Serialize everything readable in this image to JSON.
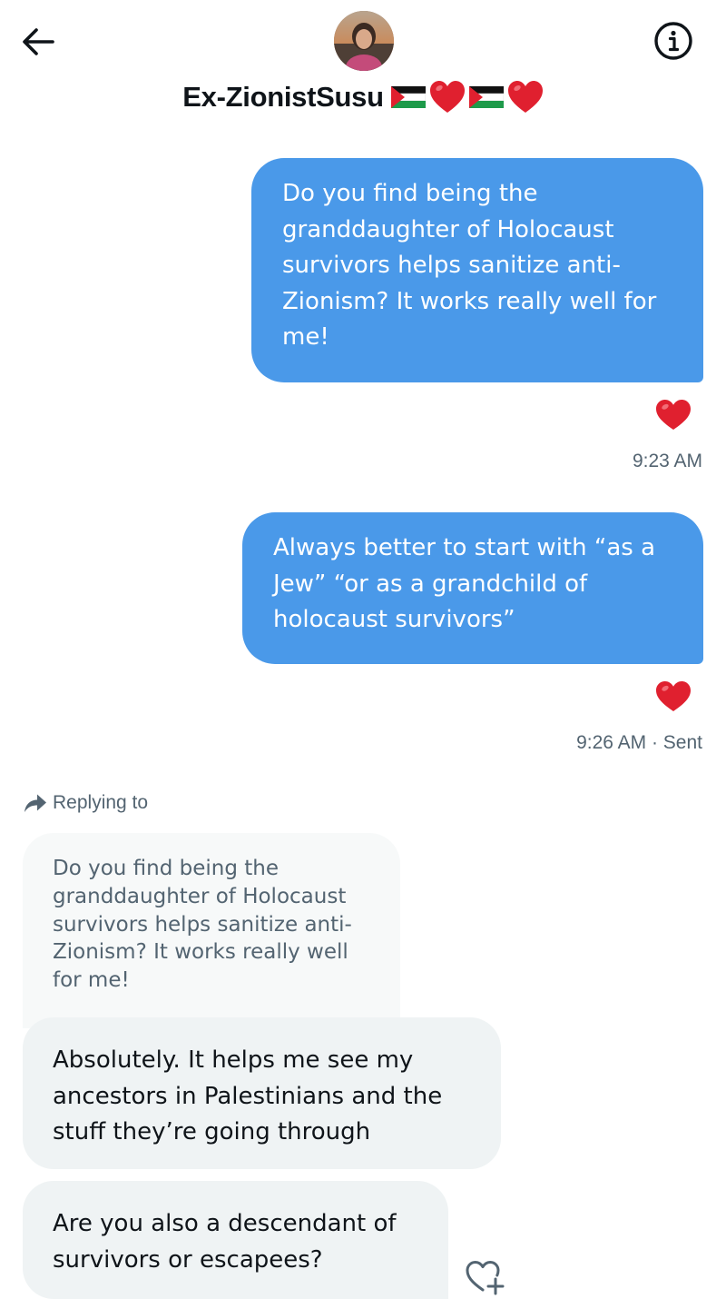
{
  "header": {
    "title": "Ex-ZionistSusu",
    "title_emoji": [
      "palestine-flag",
      "red-heart",
      "palestine-flag",
      "red-heart"
    ],
    "back_icon": "arrow-left-icon",
    "info_icon": "info-circle-icon"
  },
  "messages": [
    {
      "direction": "outgoing",
      "text": "Do you find being the granddaughter of Holocaust survivors helps sanitize anti-Zionism? It works really well for me!",
      "reaction": "red-heart",
      "time": "9:23 AM"
    },
    {
      "direction": "outgoing",
      "text": "Always better to start with “as a Jew” “or as a grandchild of holocaust survivors”",
      "reaction": "red-heart",
      "time": "9:26 AM",
      "status": "· Sent"
    }
  ],
  "reply": {
    "label": "Replying to",
    "quoted_text": "Do you find being the granddaughter of Holocaust survivors helps sanitize anti-Zionism? It works really well for me!"
  },
  "incoming": [
    {
      "text": "Absolutely. It helps me see my ancestors in Palestinians and the stuff they’re going through"
    },
    {
      "text": "Are you also a descendant of survivors or escapees?"
    }
  ],
  "colors": {
    "outgoing_bubble": "#4a99e9",
    "incoming_bubble": "#eff3f4",
    "quoted_bubble": "#f7f9f9",
    "secondary_text": "#536471",
    "heart": "#e0202f"
  }
}
